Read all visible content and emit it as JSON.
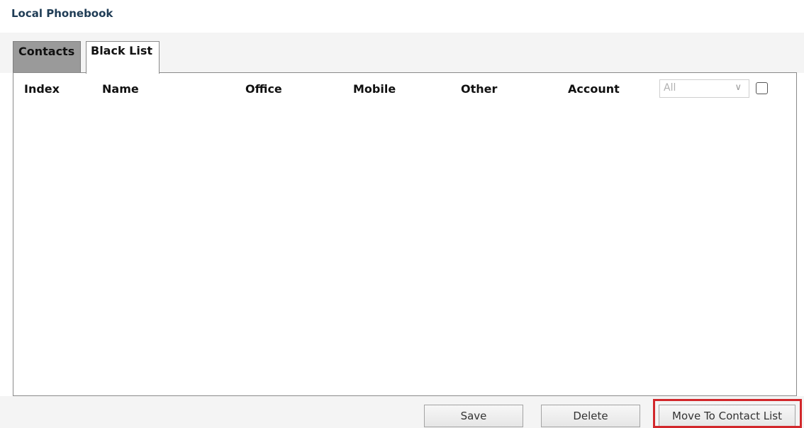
{
  "page": {
    "title": "Local Phonebook"
  },
  "tabs": [
    {
      "label": "Contacts",
      "active": false
    },
    {
      "label": "Black List",
      "active": true
    }
  ],
  "table": {
    "columns": [
      "Index",
      "Name",
      "Office",
      "Mobile",
      "Other",
      "Account"
    ],
    "rows": []
  },
  "account_filter": {
    "selected": "All",
    "chevron_icon": "chevron-down-icon"
  },
  "select_all": {
    "checked": false
  },
  "actions": {
    "save_label": "Save",
    "delete_label": "Delete",
    "move_label": "Move To Contact List"
  },
  "colors": {
    "title": "#1f3c55",
    "inactive_tab": "#9a9a9a",
    "highlight": "#d2272b"
  }
}
